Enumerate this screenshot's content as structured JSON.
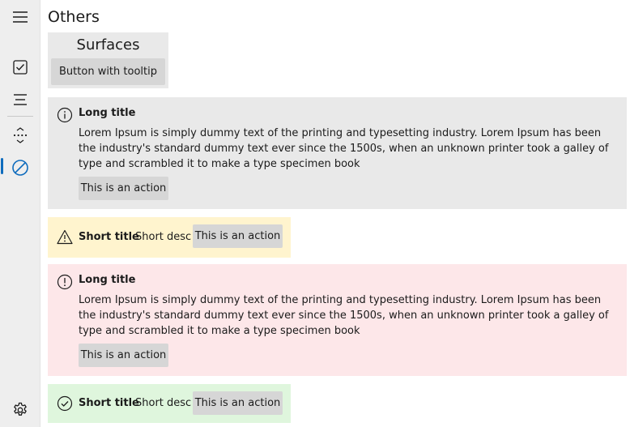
{
  "nav": {
    "items": [
      {
        "name": "hamburger-menu-icon"
      },
      {
        "name": "checkbox-icon"
      },
      {
        "name": "list-icon"
      },
      {
        "name": "more-icon"
      },
      {
        "name": "blocked-icon",
        "selected": true
      },
      {
        "name": "settings-icon"
      }
    ],
    "accent": "#0f6cbd"
  },
  "page": {
    "title": "Others"
  },
  "surfaces": {
    "title": "Surfaces",
    "button_label": "Button with tooltip"
  },
  "infobars": [
    {
      "severity": "informational",
      "title": "Long title",
      "message": "Lorem Ipsum is simply dummy text of the printing and typesetting industry. Lorem Ipsum has been the industry's standard dummy text ever since the 1500s, when an unknown printer took a galley of type and scrambled it to make a type specimen book",
      "action": "This is an action",
      "color": "#e9e9e9"
    },
    {
      "severity": "warning",
      "title": "Short title",
      "message": "Short desc",
      "action": "This is an action",
      "color": "#fff4ce"
    },
    {
      "severity": "error",
      "title": "Long title",
      "message": "Lorem Ipsum is simply dummy text of the printing and typesetting industry. Lorem Ipsum has been the industry's standard dummy text ever since the 1500s, when an unknown printer took a galley of type and scrambled it to make a type specimen book",
      "action": "This is an action",
      "color": "#fde7e9"
    },
    {
      "severity": "success",
      "title": "Short title",
      "message": "Short desc",
      "action": "This is an action",
      "color": "#dff6dd"
    }
  ]
}
